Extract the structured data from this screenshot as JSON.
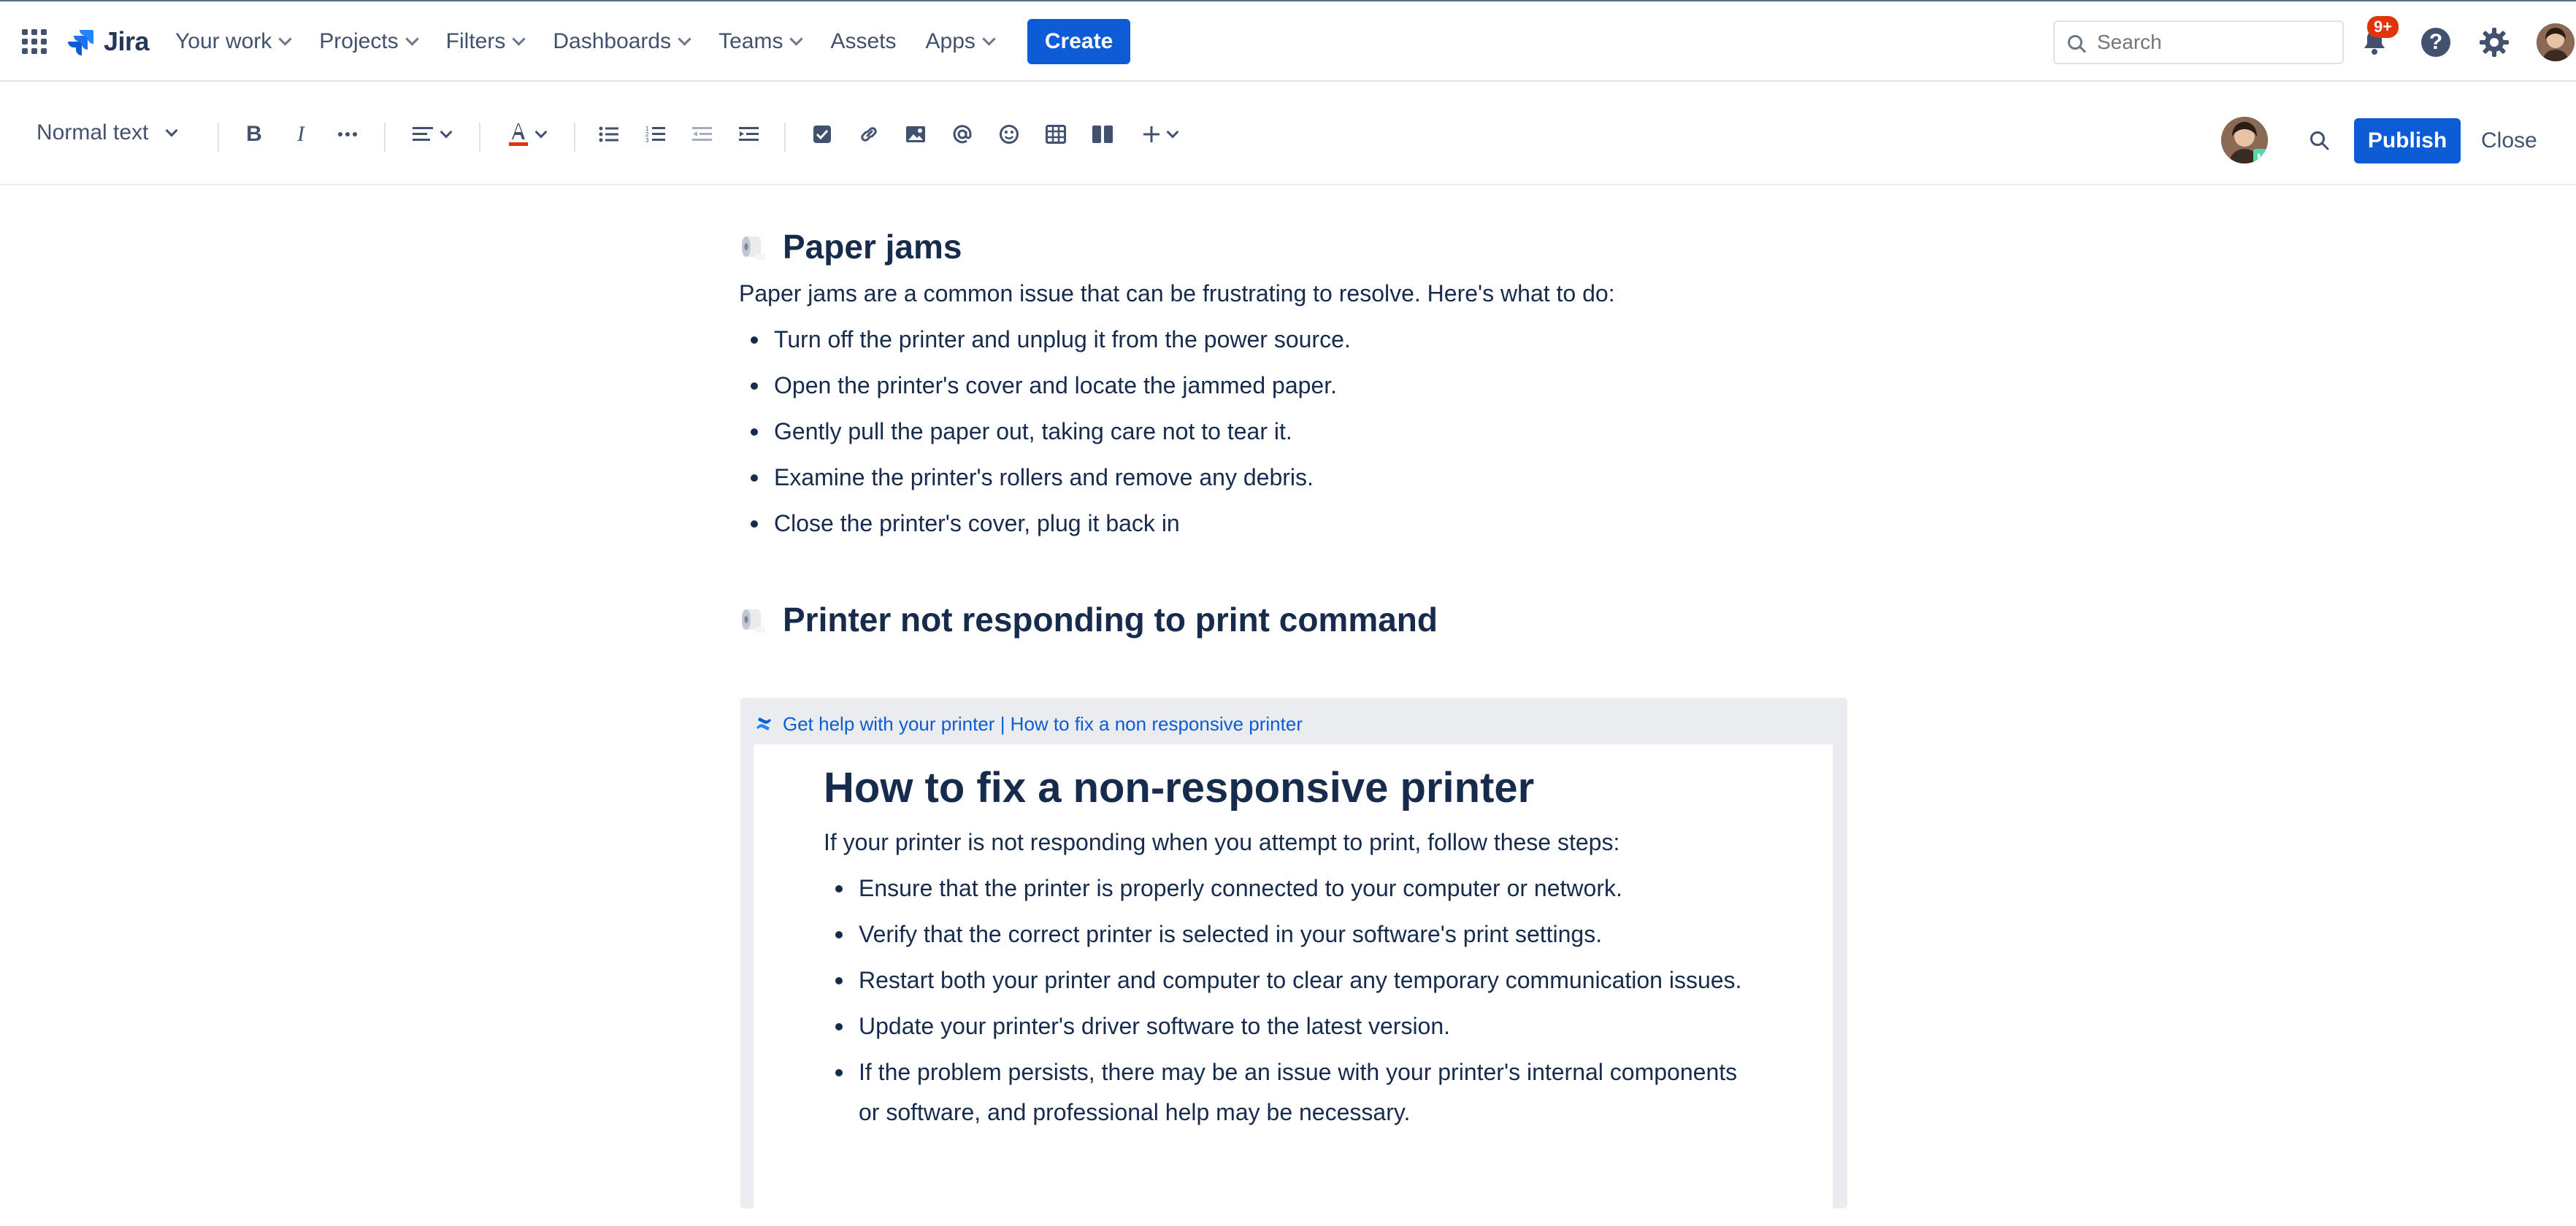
{
  "topnav": {
    "logo_text": "Jira",
    "items": [
      {
        "label": "Your work",
        "dropdown": true
      },
      {
        "label": "Projects",
        "dropdown": true
      },
      {
        "label": "Filters",
        "dropdown": true
      },
      {
        "label": "Dashboards",
        "dropdown": true
      },
      {
        "label": "Teams",
        "dropdown": true
      },
      {
        "label": "Assets",
        "dropdown": false
      },
      {
        "label": "Apps",
        "dropdown": true
      }
    ],
    "create_label": "Create",
    "search_placeholder": "Search",
    "notification_badge": "9+",
    "help_glyph": "?"
  },
  "toolbar": {
    "text_style": "Normal text",
    "publish_label": "Publish",
    "close_label": "Close",
    "collaborator_initial": "M"
  },
  "colors": {
    "brand_blue": "#0c5cd6",
    "text": "#172b4d",
    "nav_text": "#42526e",
    "badge_red": "#de350b",
    "excerpt_bg": "#ebecf0"
  },
  "content": {
    "section1": {
      "heading": "Paper jams",
      "intro": "Paper jams are a common issue that can be frustrating to resolve. Here's what to do:",
      "steps": [
        "Turn off the printer and unplug it from the power source.",
        "Open the printer's cover and locate the jammed paper.",
        "Gently pull the paper out, taking care not to tear it.",
        "Examine the printer's rollers and remove any debris.",
        "Close the printer's cover, plug it back in"
      ]
    },
    "section2": {
      "heading": "Printer not responding to print command",
      "excerpt": {
        "source_label": "Get help with your printer | How to fix a non responsive printer",
        "title": "How to fix a non-responsive printer",
        "intro": "If your printer is not responding when you attempt to print, follow these steps:",
        "steps": [
          "Ensure that the printer is properly connected to your computer or network.",
          "Verify that the correct printer is selected in your software's print settings.",
          "Restart both your printer and computer to clear any temporary communication issues.",
          "Update your printer's driver software to the latest version.",
          "If the problem persists, there may be an issue with your printer's internal components or software, and professional help may be necessary."
        ]
      }
    }
  }
}
